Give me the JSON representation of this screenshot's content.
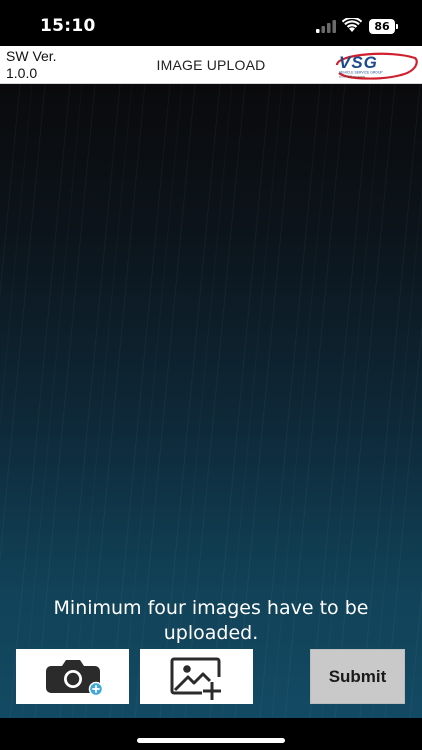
{
  "status_bar": {
    "time": "15:10",
    "battery_level": "86",
    "icons": [
      "signal-icon",
      "wifi-icon",
      "battery-icon"
    ]
  },
  "header": {
    "sw_version": "SW Ver. 1.0.0",
    "title": "IMAGE UPLOAD",
    "logo": {
      "text": "VSG",
      "subtitle": "VEHICLE SERVICE GROUP",
      "tagline": "a DOVER company",
      "colors": {
        "text": "#1c4a8c",
        "swoosh": "#d0202e"
      }
    }
  },
  "main": {
    "background_colors": {
      "top": "#0a0a0c",
      "bottom": "#134a63"
    },
    "info_text": "Minimum four images have to be uploaded."
  },
  "actions": {
    "camera_icon": "camera-add-icon",
    "gallery_icon": "gallery-add-icon",
    "submit_label": "Submit",
    "colors": {
      "icon": "#2b2b2b",
      "plus_badge": "#3ea9d6",
      "submit_bg": "#c9c9c9"
    }
  }
}
